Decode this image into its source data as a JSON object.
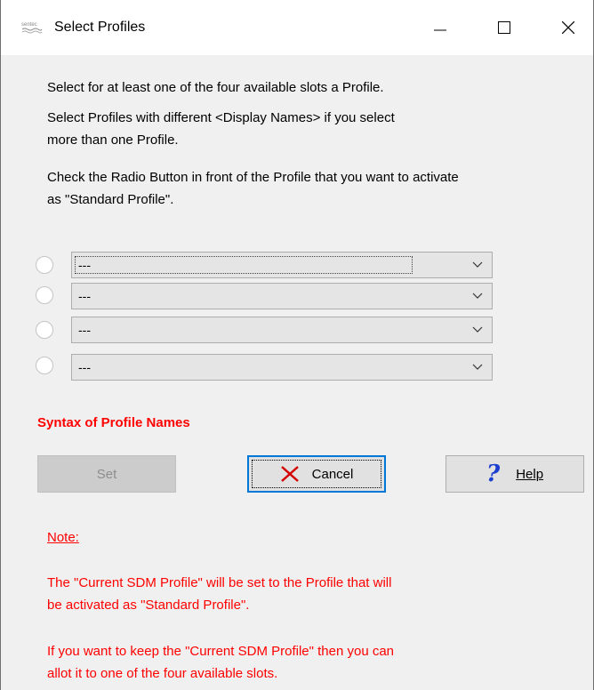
{
  "window": {
    "title": "Select Profiles",
    "icon_text": "sentec"
  },
  "instructions": {
    "line1": "Select for at least one of the four available slots a Profile.",
    "line2a": "Select Profiles with different <Display Names> if you select",
    "line2b": "more than one Profile.",
    "line3a": "Check the Radio Button in front of the Profile that you want to activate",
    "line3b": "as \"Standard Profile\"."
  },
  "slots": [
    {
      "value": "---",
      "selected": false
    },
    {
      "value": "---",
      "selected": false
    },
    {
      "value": "---",
      "selected": false
    },
    {
      "value": "---",
      "selected": false
    }
  ],
  "syntax_link": "Syntax of Profile Names",
  "buttons": {
    "set": "Set",
    "cancel": "Cancel",
    "help": "Help"
  },
  "note": {
    "heading": "Note:",
    "p1a": "The \"Current SDM Profile\" will be set to the Profile that will",
    "p1b": "be activated as \"Standard Profile\".",
    "p2a": "If you want to keep the \"Current SDM Profile\" then you can",
    "p2b": "allot it to one of the four available slots."
  },
  "colors": {
    "accent": "#0078d7",
    "warning_text": "#ff0000",
    "window_bg": "#f0f0f0"
  },
  "icons": [
    "app-logo-icon",
    "minimize-icon",
    "maximize-icon",
    "close-icon",
    "chevron-down-icon",
    "cancel-x-icon",
    "help-question-icon"
  ]
}
